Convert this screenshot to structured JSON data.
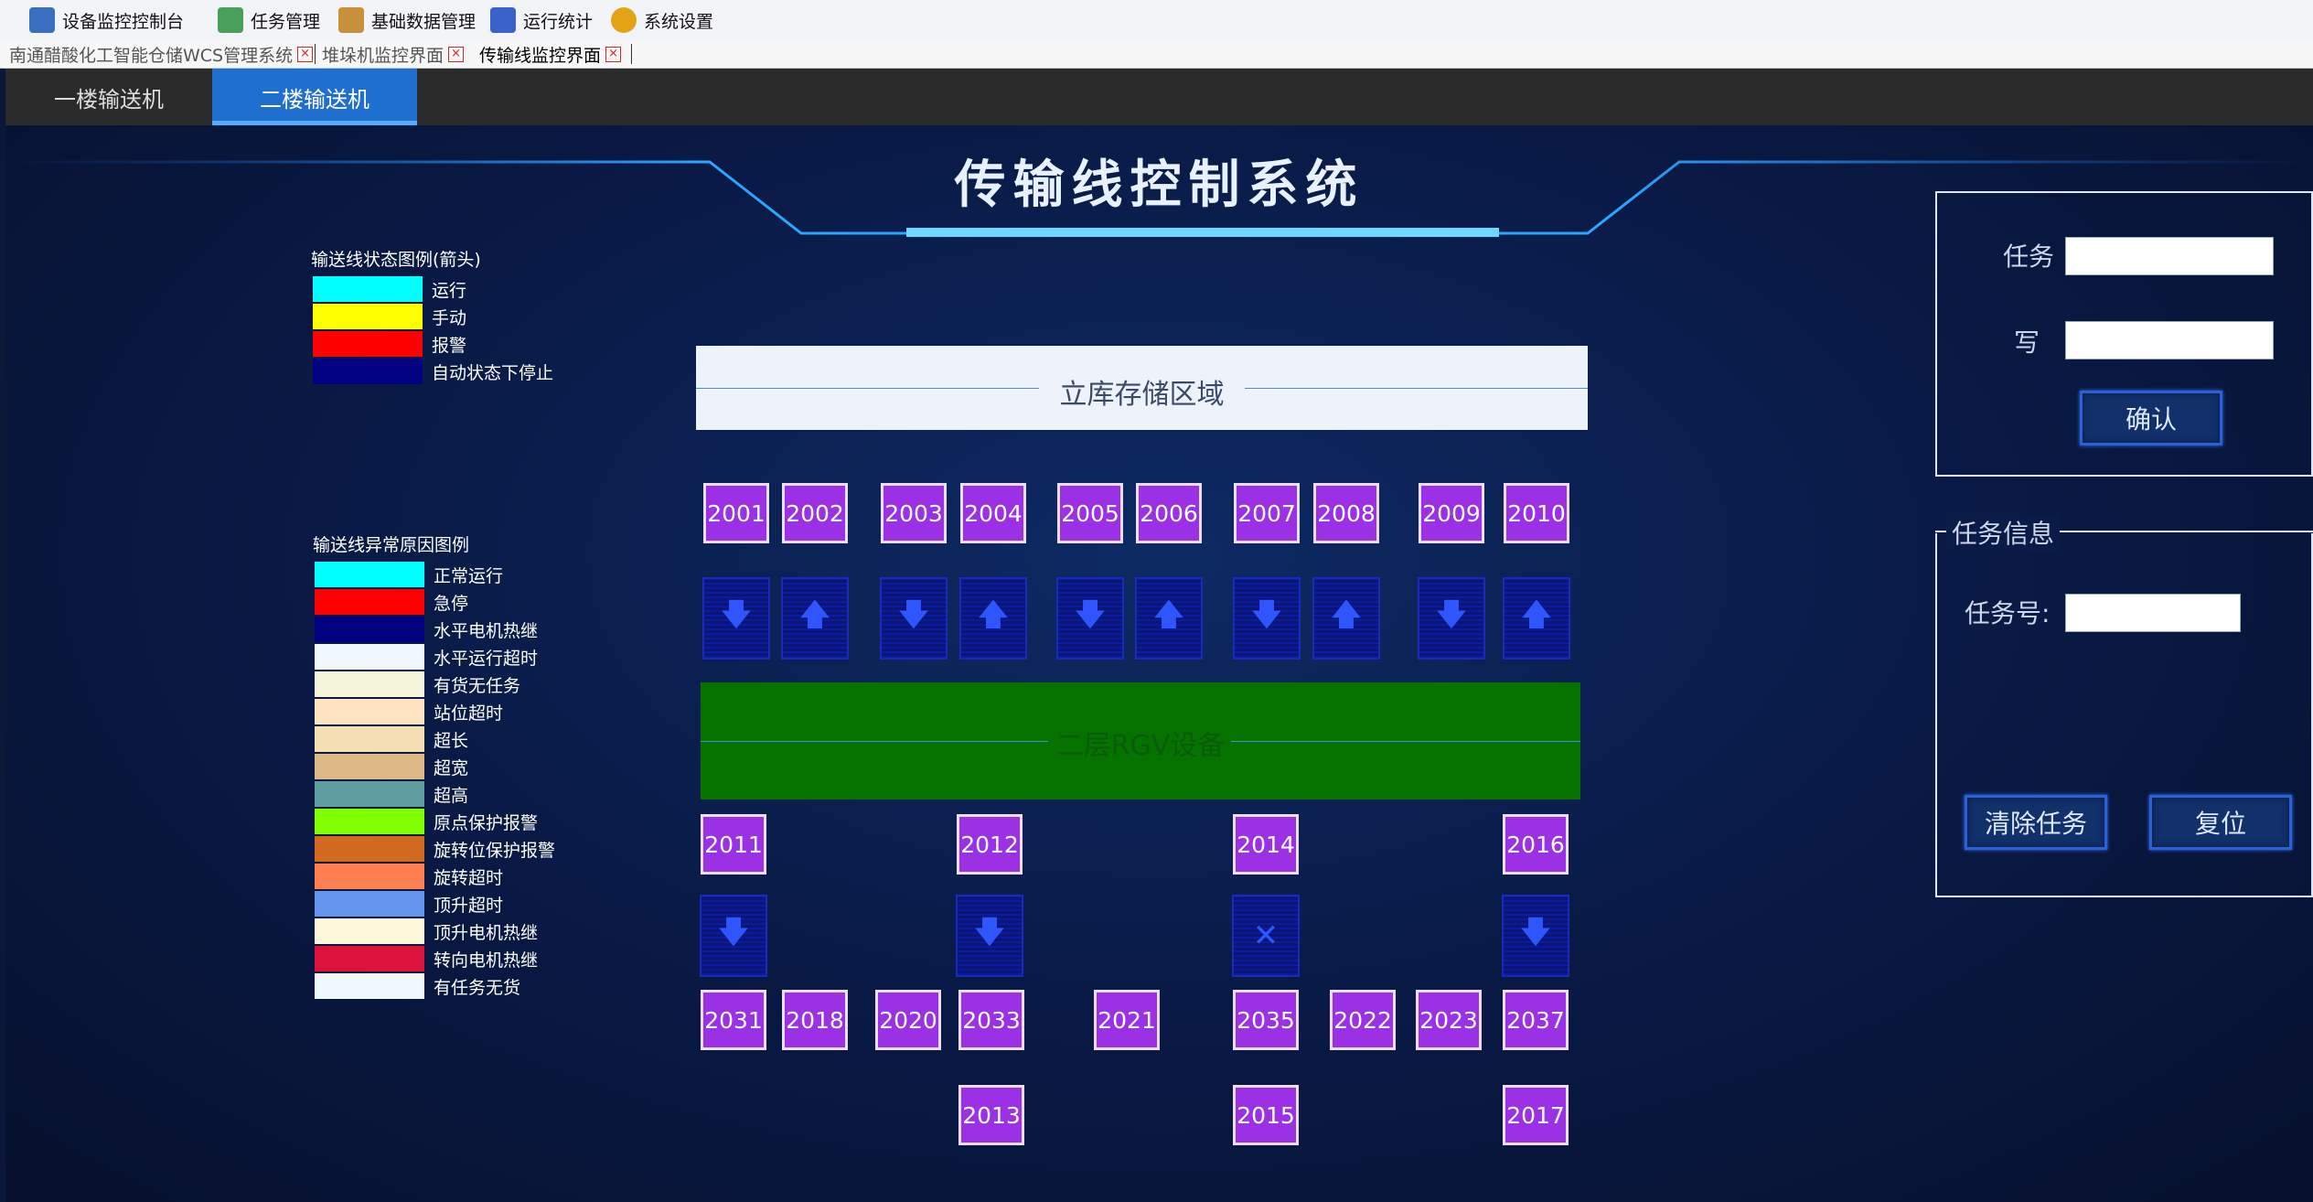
{
  "menu": [
    {
      "label": "设备监控控制台",
      "icon": "monitor-console-icon",
      "color": "#3a6fc0"
    },
    {
      "label": "任务管理",
      "icon": "task-doc-icon",
      "color": "#4aa05a"
    },
    {
      "label": "基础数据管理",
      "icon": "data-edit-icon",
      "color": "#c8903a"
    },
    {
      "label": "运行统计",
      "icon": "bar-chart-icon",
      "color": "#3b62c8"
    },
    {
      "label": "系统设置",
      "icon": "gear-icon",
      "color": "#e2a315"
    }
  ],
  "doc_tabs": [
    {
      "label": "南通醋酸化工智能仓储WCS管理系统"
    },
    {
      "label": "堆垛机监控界面"
    },
    {
      "label": "传输线监控界面"
    }
  ],
  "floor_tabs": [
    {
      "label": "一楼输送机"
    },
    {
      "label": "二楼输送机"
    }
  ],
  "title": "传输线控制系统",
  "status_legend": {
    "title": "输送线状态图例(箭头)",
    "items": [
      {
        "label": "运行",
        "color": "#00ffff"
      },
      {
        "label": "手动",
        "color": "#ffff00"
      },
      {
        "label": "报警",
        "color": "#ff0000"
      },
      {
        "label": "自动状态下停止",
        "color": "#000080"
      }
    ]
  },
  "fault_legend": {
    "title": "输送线异常原因图例",
    "items": [
      {
        "label": "正常运行",
        "color": "#00ffff"
      },
      {
        "label": "急停",
        "color": "#ff0000"
      },
      {
        "label": "水平电机热继",
        "color": "#000080"
      },
      {
        "label": "水平运行超时",
        "color": "#f0f8ff"
      },
      {
        "label": "有货无任务",
        "color": "#f5f5dc"
      },
      {
        "label": "站位超时",
        "color": "#ffe4c4"
      },
      {
        "label": "超长",
        "color": "#f5deb3"
      },
      {
        "label": "超宽",
        "color": "#deb887"
      },
      {
        "label": "超高",
        "color": "#5f9ea0"
      },
      {
        "label": "原点保护报警",
        "color": "#7fff00"
      },
      {
        "label": "旋转位保护报警",
        "color": "#d2691e"
      },
      {
        "label": "旋转超时",
        "color": "#ff7f50"
      },
      {
        "label": "顶升超时",
        "color": "#6495ed"
      },
      {
        "label": "顶升电机热继",
        "color": "#fff8dc"
      },
      {
        "label": "转向电机热继",
        "color": "#dc143c"
      },
      {
        "label": "有任务无货",
        "color": "#f0f8ff"
      }
    ]
  },
  "storage_area": "立库存储区域",
  "rgv_area": "二层RGV设备",
  "top_stations": [
    "2001",
    "2002",
    "2003",
    "2004",
    "2005",
    "2006",
    "2007",
    "2008",
    "2009",
    "2010"
  ],
  "top_arrows": [
    "down",
    "up",
    "down",
    "up",
    "down",
    "up",
    "down",
    "up",
    "down",
    "up"
  ],
  "mid_stations": [
    "2011",
    "2012",
    "2014",
    "2016"
  ],
  "mid_arrows": [
    "down",
    "down",
    "cross",
    "down"
  ],
  "lower_stations": [
    "2031",
    "2018",
    "2020",
    "2033",
    "2021",
    "2035",
    "2022",
    "2023",
    "2037"
  ],
  "bottom_stations": [
    "2013",
    "2015",
    "2017"
  ],
  "task_panel": {
    "task_label": "任务",
    "task_value": "",
    "write_label": "写",
    "write_value": "",
    "confirm_label": "确认"
  },
  "info_panel": {
    "title": "任务信息",
    "task_no_label": "任务号:",
    "task_no_value": "",
    "clear_label": "清除任务",
    "reset_label": "复位"
  }
}
